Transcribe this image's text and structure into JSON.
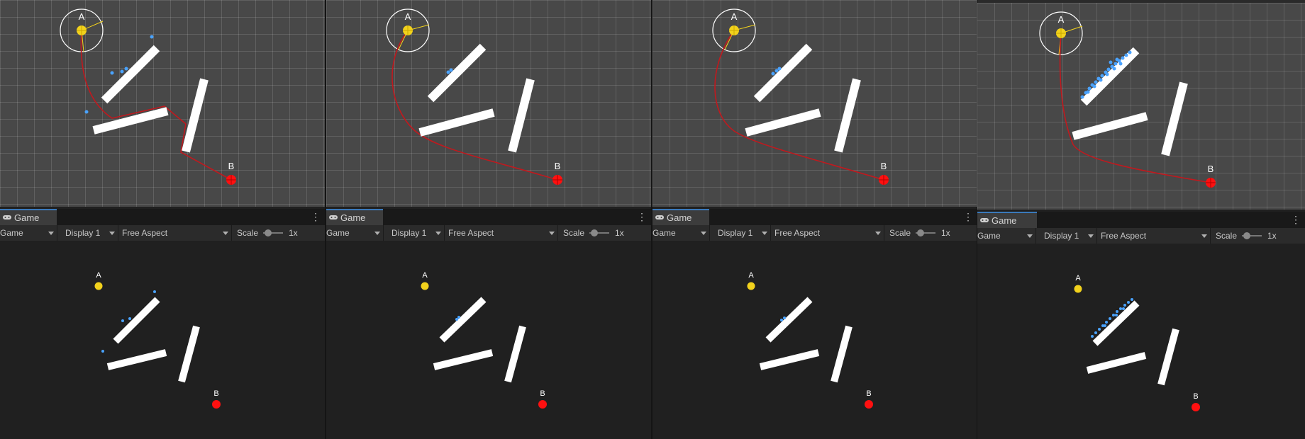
{
  "colors": {
    "accent": "#3a79bb",
    "scene_bg": "#484848",
    "game_bg": "#202020",
    "goal_a": "#f2d21c",
    "goal_b": "#ff1010",
    "path": "#c0191e",
    "particle": "#4aa3ff",
    "wall": "#ffffff"
  },
  "panels": [
    {
      "scene": {
        "label_a": "A",
        "label_b": "B"
      },
      "game": {
        "tab_label": "Game",
        "tab_icon": "gamepad-icon",
        "menu_icon": "kebab-icon",
        "mode_select": "Game",
        "display_select": "Display 1",
        "aspect_select": "Free Aspect",
        "scale_label": "Scale",
        "scale_value": "1x",
        "label_a": "A",
        "label_b": "B"
      }
    },
    {
      "scene": {
        "label_a": "A",
        "label_b": "B"
      },
      "game": {
        "tab_label": "Game",
        "tab_icon": "gamepad-icon",
        "menu_icon": "kebab-icon",
        "mode_select": "Game",
        "display_select": "Display 1",
        "aspect_select": "Free Aspect",
        "scale_label": "Scale",
        "scale_value": "1x",
        "label_a": "A",
        "label_b": "B"
      }
    },
    {
      "scene": {
        "label_a": "A",
        "label_b": "B"
      },
      "game": {
        "tab_label": "Game",
        "tab_icon": "gamepad-icon",
        "menu_icon": "kebab-icon",
        "mode_select": "Game",
        "display_select": "Display 1",
        "aspect_select": "Free Aspect",
        "scale_label": "Scale",
        "scale_value": "1x",
        "label_a": "A",
        "label_b": "B"
      }
    },
    {
      "scene": {
        "label_a": "A",
        "label_b": "B"
      },
      "game": {
        "tab_label": "Game",
        "tab_icon": "gamepad-icon",
        "menu_icon": "kebab-icon",
        "mode_select": "Game",
        "display_select": "Display 1",
        "aspect_select": "Free Aspect",
        "scale_label": "Scale",
        "scale_value": "1x",
        "label_a": "A",
        "label_b": "B"
      }
    }
  ]
}
